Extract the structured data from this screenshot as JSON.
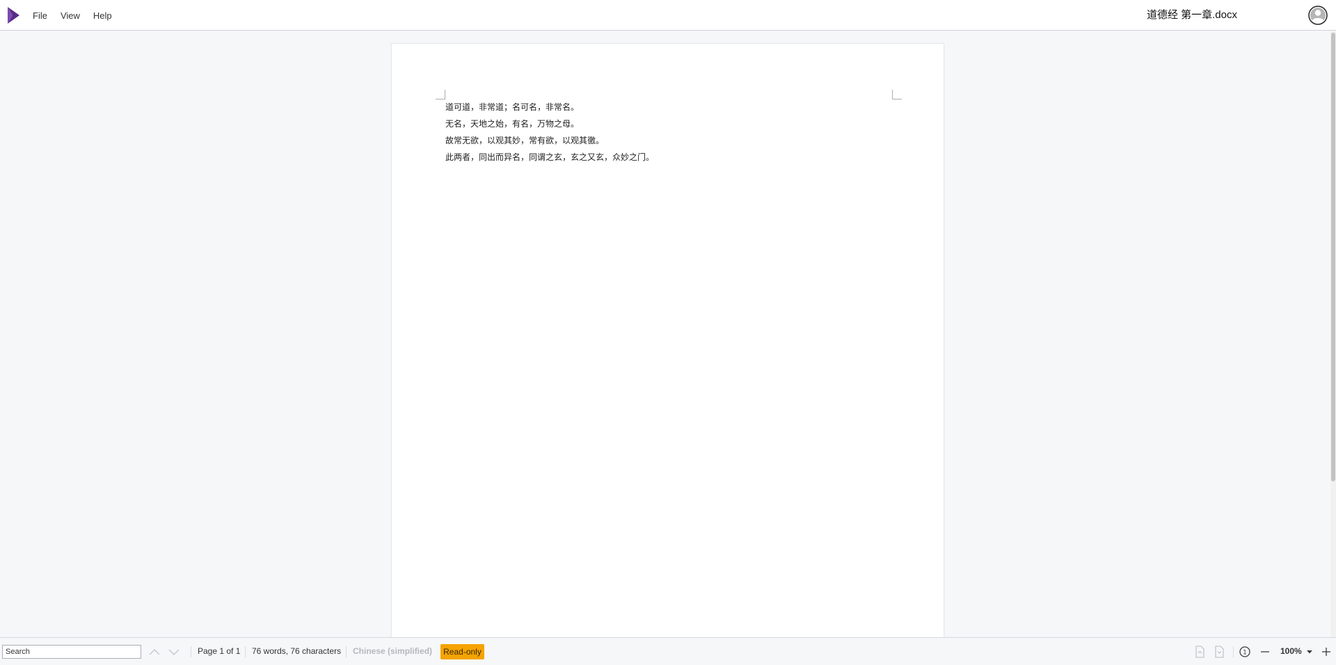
{
  "app": {
    "logo_icon": "app-logo-icon",
    "logo_color": "#5b2b8a"
  },
  "menu": {
    "items": [
      {
        "label": "File"
      },
      {
        "label": "View"
      },
      {
        "label": "Help"
      }
    ]
  },
  "header": {
    "doc_title": "道德经 第一章.docx",
    "avatar_icon": "user-avatar-icon"
  },
  "document": {
    "lines": [
      "道可道，非常道；名可名，非常名。",
      "无名，天地之始，有名，万物之母。",
      "故常无欲，以观其妙，常有欲，以观其徼。",
      "此两者，同出而异名，同谓之玄，玄之又玄，众妙之门。"
    ]
  },
  "statusbar": {
    "search_placeholder": "Search",
    "page_info": "Page 1 of 1",
    "word_count": "76 words, 76 characters",
    "language": "Chinese (simplified)",
    "readonly_label": "Read-only",
    "readonly_color": "#f5a300",
    "zoom": "100%"
  }
}
